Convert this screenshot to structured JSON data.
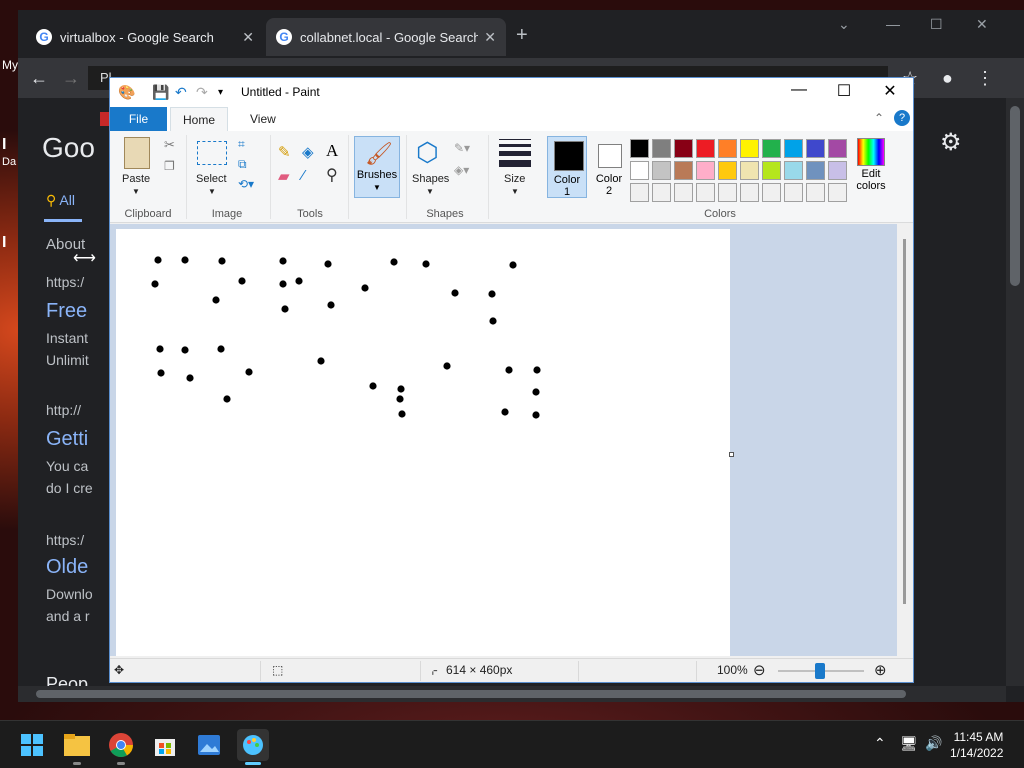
{
  "chrome": {
    "tabs": [
      {
        "title": "virtualbox - Google Search"
      },
      {
        "title": "collabnet.local - Google Search"
      }
    ],
    "new_tab": "+",
    "left_edge_text": [
      "My",
      "I",
      "Da",
      "I"
    ],
    "behind_window_title": "Pl",
    "google": {
      "logo": "Goo",
      "tab_all": "All",
      "about": "About",
      "results": [
        {
          "url": "https:/",
          "title": "Free",
          "lines": [
            "Instant",
            "Unlimit"
          ]
        },
        {
          "url": "http://",
          "title": "Getti",
          "lines": [
            "You ca",
            "do I cre"
          ]
        },
        {
          "url": "https:/",
          "title": "Olde",
          "lines": [
            "Downlo",
            "and a r"
          ]
        }
      ],
      "footer_fragment": "Peop"
    },
    "colors": {
      "page_bg": "#202124",
      "link": "#8ab4f8"
    }
  },
  "paint": {
    "title": "Untitled - Paint",
    "ribbon_tabs": {
      "file": "File",
      "home": "Home",
      "view": "View"
    },
    "help": "?",
    "groups": {
      "clipboard": "Clipboard",
      "image": "Image",
      "tools": "Tools",
      "shapes": "Shapes",
      "colors": "Colors"
    },
    "buttons": {
      "paste": "Paste",
      "select": "Select",
      "brushes": "Brushes",
      "shapes": "Shapes",
      "size": "Size",
      "color1": "Color\n1",
      "color1_line1": "Color",
      "color1_line2": "1",
      "color2_line1": "Color",
      "color2_line2": "2",
      "edit_colors_line1": "Edit",
      "edit_colors_line2": "colors"
    },
    "color1": "#000000",
    "color2": "#ffffff",
    "palette": [
      "#000000",
      "#7f7f7f",
      "#880015",
      "#ed1c24",
      "#ff7f27",
      "#fff200",
      "#22b14c",
      "#00a2e8",
      "#3f48cc",
      "#a349a4",
      "#ffffff",
      "#c3c3c3",
      "#b97a57",
      "#ffaec9",
      "#ffc90e",
      "#efe4b0",
      "#b5e61d",
      "#99d9ea",
      "#7092be",
      "#c8bfe7",
      "#f0f0f0",
      "#f0f0f0",
      "#f0f0f0",
      "#f0f0f0",
      "#f0f0f0",
      "#f0f0f0",
      "#f0f0f0",
      "#f0f0f0",
      "#f0f0f0",
      "#f0f0f0"
    ],
    "status": {
      "dimensions": "614 × 460px",
      "zoom": "100%"
    },
    "zoom_level": 1.0
  },
  "taskbar": {
    "apps": [
      "start-icon",
      "file-explorer-icon",
      "chrome-icon",
      "store-icon",
      "photos-icon",
      "paint-icon"
    ],
    "time": "11:45 AM",
    "date": "1/14/2022"
  }
}
